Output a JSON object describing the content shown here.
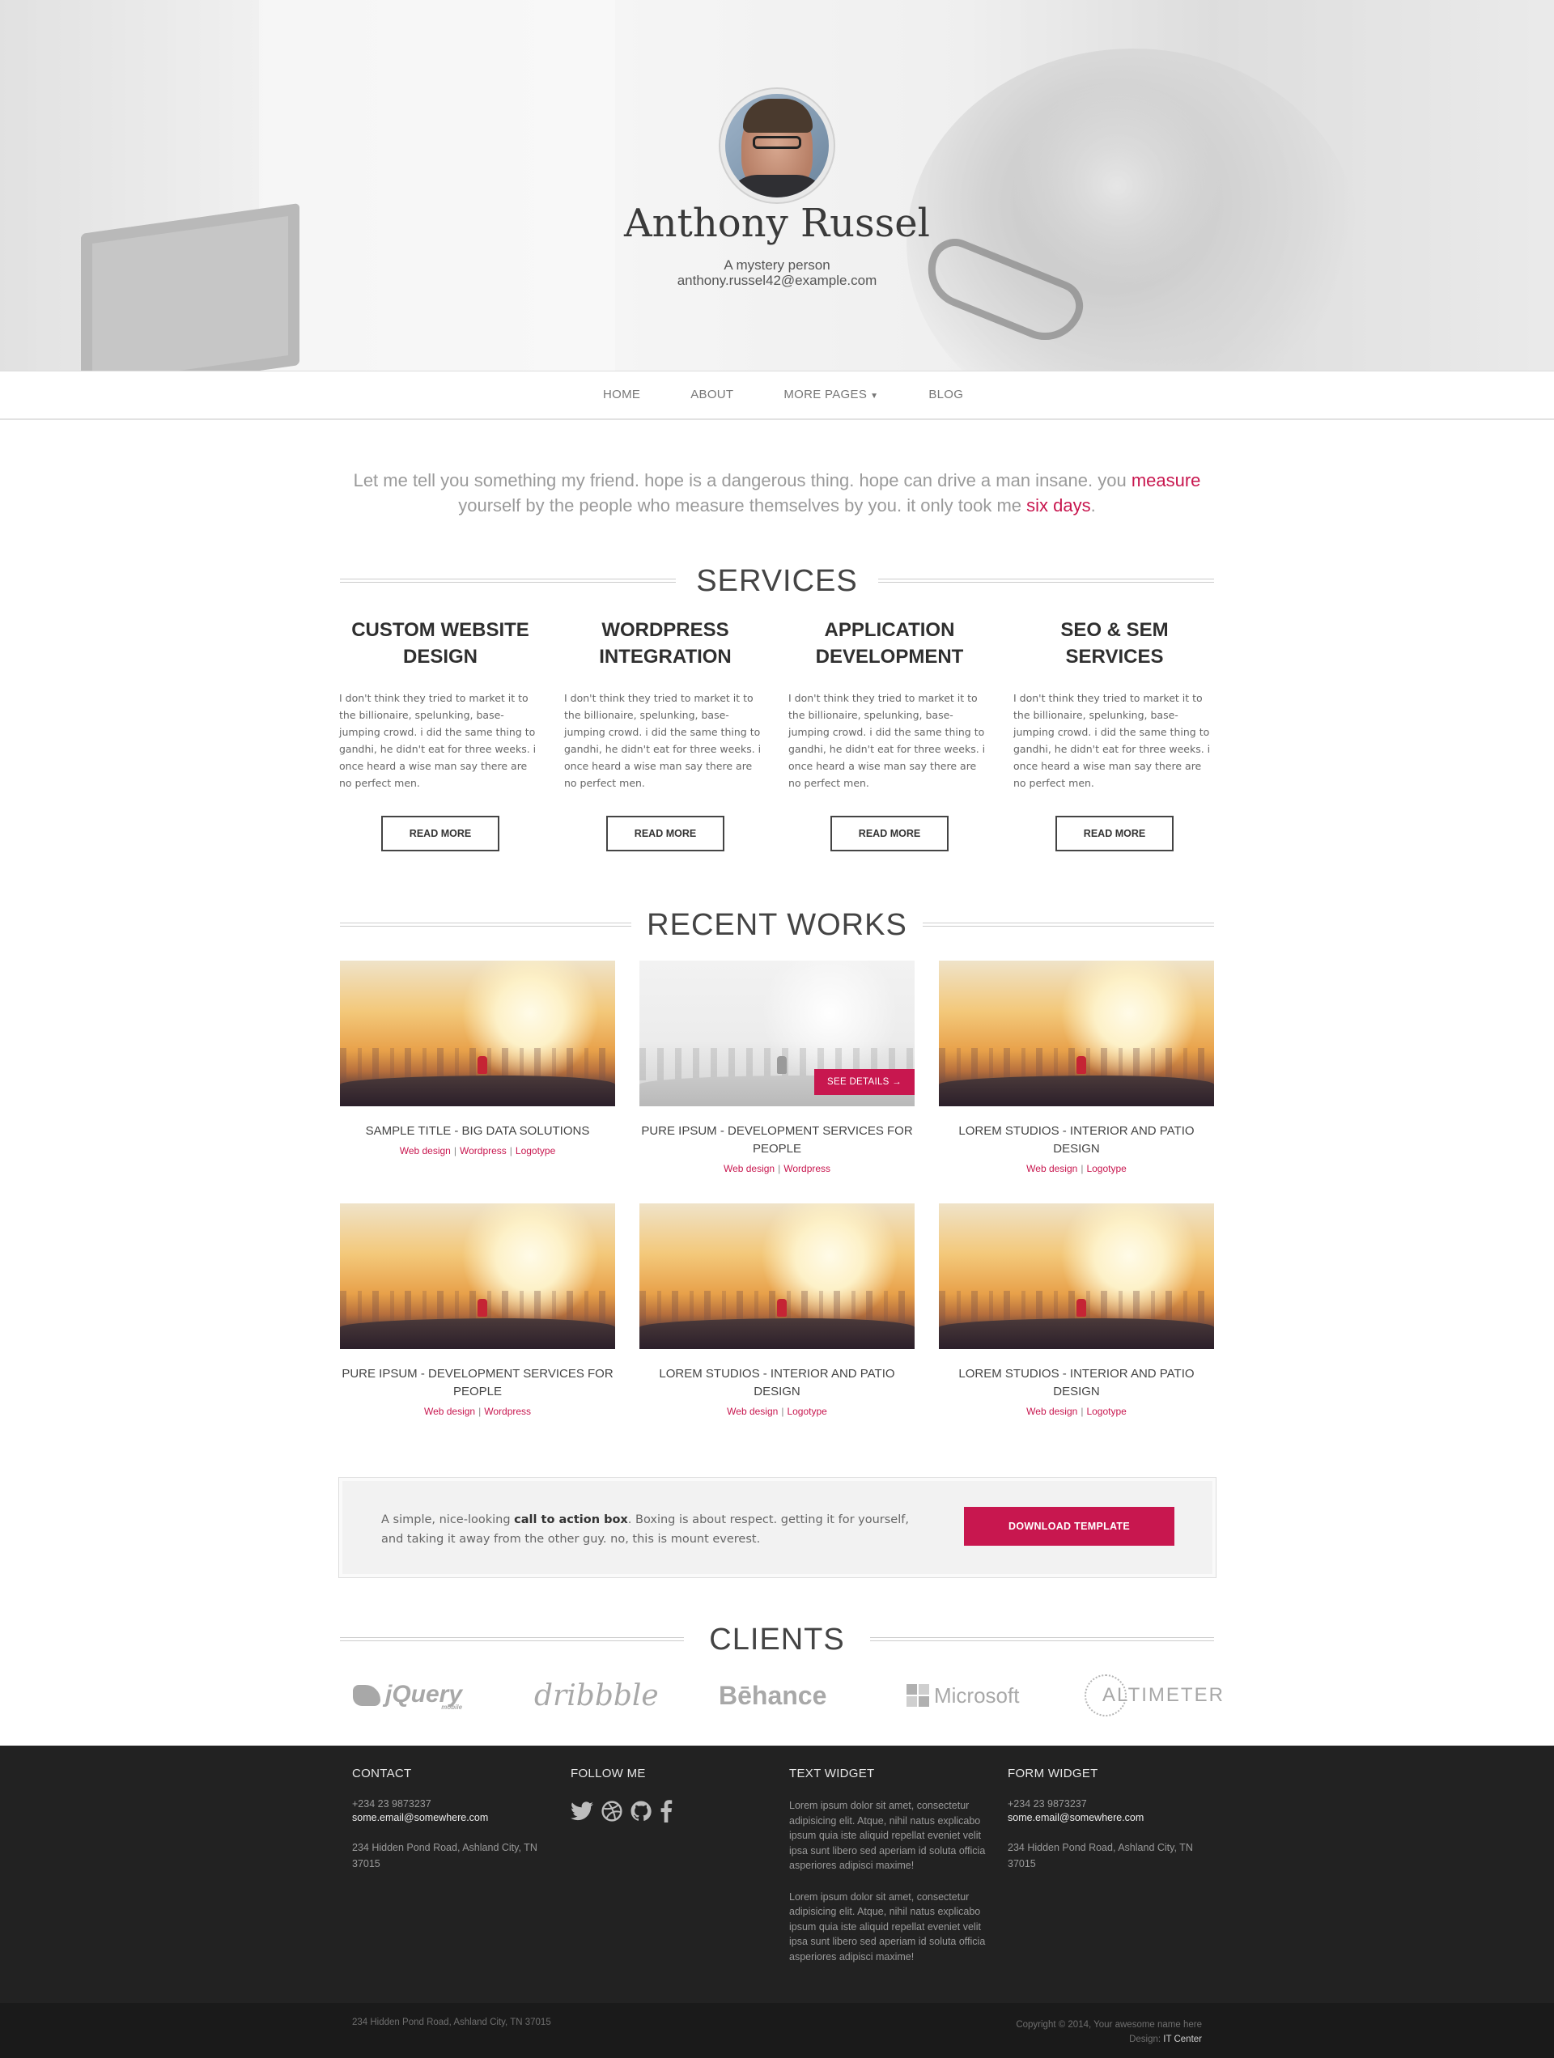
{
  "hero": {
    "name": "Anthony Russel",
    "tagline": "A mystery person",
    "email": "anthony.russel42@example.com"
  },
  "nav": {
    "items": [
      "HOME",
      "ABOUT",
      "MORE PAGES",
      "BLOG"
    ]
  },
  "intro": {
    "part1": "Let me tell you something my friend. hope is a dangerous thing. hope can drive a man insane. you ",
    "hl1": "measure",
    "part2": " yourself by the people who measure themselves by you. it only took me ",
    "hl2": "six days",
    "part3": "."
  },
  "services": {
    "title": "SERVICES",
    "items": [
      {
        "title": "CUSTOM WEBSITE DESIGN",
        "text": "I don't think they tried to market it to the billionaire, spelunking, base-jumping crowd. i did the same thing to gandhi, he didn't eat for three weeks. i once heard a wise man say there are no perfect men.",
        "button": "READ MORE"
      },
      {
        "title": "WORDPRESS INTEGRATION",
        "text": "I don't think they tried to market it to the billionaire, spelunking, base-jumping crowd. i did the same thing to gandhi, he didn't eat for three weeks. i once heard a wise man say there are no perfect men.",
        "button": "READ MORE"
      },
      {
        "title": "APPLICATION DEVELOPMENT",
        "text": "I don't think they tried to market it to the billionaire, spelunking, base-jumping crowd. i did the same thing to gandhi, he didn't eat for three weeks. i once heard a wise man say there are no perfect men.",
        "button": "READ MORE"
      },
      {
        "title": "SEO & SEM SERVICES",
        "text": "I don't think they tried to market it to the billionaire, spelunking, base-jumping crowd. i did the same thing to gandhi, he didn't eat for three weeks. i once heard a wise man say there are no perfect men.",
        "button": "READ MORE"
      }
    ]
  },
  "works": {
    "title": "RECENT WORKS",
    "details_label": "SEE DETAILS →",
    "items": [
      {
        "title": "SAMPLE TITLE - BIG DATA SOLUTIONS",
        "tags": [
          "Web design",
          "Wordpress",
          "Logotype"
        ]
      },
      {
        "title": "PURE IPSUM - DEVELOPMENT SERVICES FOR PEOPLE",
        "tags": [
          "Web design",
          "Wordpress"
        ]
      },
      {
        "title": "LOREM STUDIOS - INTERIOR AND PATIO DESIGN",
        "tags": [
          "Web design",
          "Logotype"
        ]
      },
      {
        "title": "PURE IPSUM - DEVELOPMENT SERVICES FOR PEOPLE",
        "tags": [
          "Web design",
          "Wordpress"
        ]
      },
      {
        "title": "LOREM STUDIOS - INTERIOR AND PATIO DESIGN",
        "tags": [
          "Web design",
          "Logotype"
        ]
      },
      {
        "title": "LOREM STUDIOS - INTERIOR AND PATIO DESIGN",
        "tags": [
          "Web design",
          "Logotype"
        ]
      }
    ]
  },
  "cta": {
    "text_pre": "A simple, nice-looking ",
    "text_bold": "call to action box",
    "text_post": ". Boxing is about respect. getting it for yourself, and taking it away from the other guy. no, this is mount everest.",
    "button": "DOWNLOAD TEMPLATE"
  },
  "clients": {
    "title": "CLIENTS",
    "logos": [
      "jQuery",
      "mobile",
      "dribbble",
      "Bēhance",
      "Microsoft",
      "ALTIMETER"
    ]
  },
  "footer": {
    "contact": {
      "title": "CONTACT",
      "phone": "+234 23 9873237",
      "email": "some.email@somewhere.com",
      "address": "234 Hidden Pond Road, Ashland City, TN 37015"
    },
    "follow": {
      "title": "FOLLOW ME",
      "icons": [
        "twitter-icon",
        "dribbble-icon",
        "github-icon",
        "facebook-icon"
      ]
    },
    "text_widget": {
      "title": "TEXT WIDGET",
      "para1": "Lorem ipsum dolor sit amet, consectetur adipisicing elit. Atque, nihil natus explicabo ipsum quia iste aliquid repellat eveniet velit ipsa sunt libero sed aperiam id soluta officia asperiores adipisci maxime!",
      "para2": "Lorem ipsum dolor sit amet, consectetur adipisicing elit. Atque, nihil natus explicabo ipsum quia iste aliquid repellat eveniet velit ipsa sunt libero sed aperiam id soluta officia asperiores adipisci maxime!"
    },
    "form_widget": {
      "title": "FORM WIDGET",
      "phone": "+234 23 9873237",
      "email": "some.email@somewhere.com",
      "address": "234 Hidden Pond Road, Ashland City, TN 37015"
    }
  },
  "bottom": {
    "address": "234 Hidden Pond Road, Ashland City, TN 37015",
    "copyright": "Copyright © 2014, Your awesome name here",
    "design_label": "Design: ",
    "design_link": "IT Center"
  },
  "colors": {
    "accent": "#c8174f",
    "footer_bg": "#222222",
    "bottom_bg": "#1a1a1a"
  }
}
